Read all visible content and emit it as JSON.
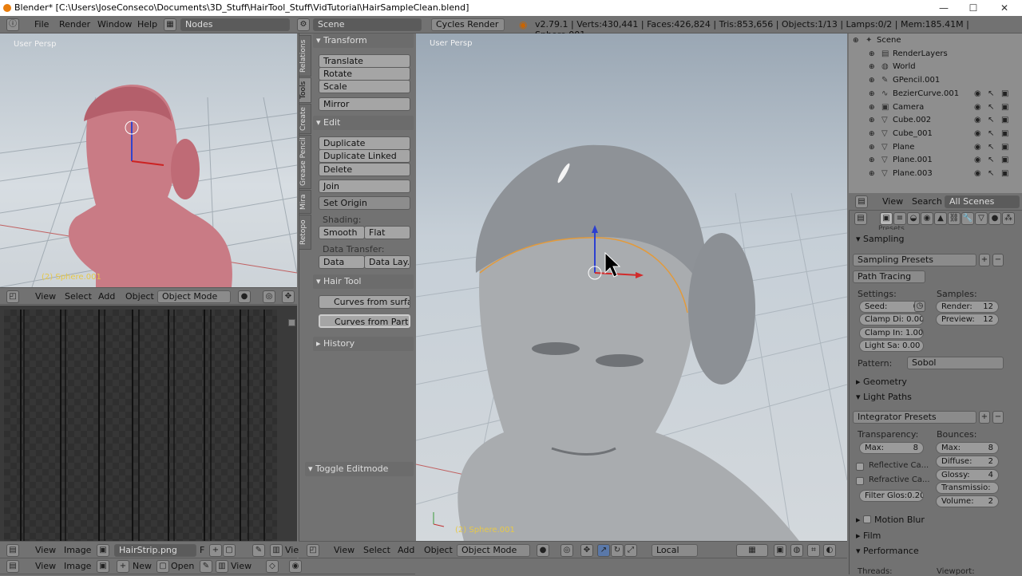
{
  "window": {
    "title": "Blender* [C:\\Users\\JoseConseco\\Documents\\3D_Stuff\\HairTool_Stuff\\VidTutorial\\HairSampleClean.blend]"
  },
  "info_header": {
    "menus": [
      "File",
      "Render",
      "Window",
      "Help"
    ],
    "screen_layout": "Nodes",
    "scene": "Scene",
    "render_engine": "Cycles Render",
    "stats": "v2.79.1 | Verts:430,441 | Faces:426,824 | Tris:853,656 | Objects:1/13 | Lamps:0/2 | Mem:185.41M | Sphere.001"
  },
  "left_viewport": {
    "label": "User Persp",
    "object_label": "(2) Sphere.001",
    "header": {
      "menus": [
        "View",
        "Select",
        "Add",
        "Object"
      ],
      "mode": "Object Mode"
    }
  },
  "tool_shelf": {
    "tabs": [
      "Relations",
      "Tools",
      "Create",
      "Grease Pencil",
      "Mira",
      "Retopo"
    ],
    "transform": {
      "title": "Transform",
      "buttons": [
        "Translate",
        "Rotate",
        "Scale",
        "Mirror"
      ]
    },
    "edit": {
      "title": "Edit",
      "buttons": [
        "Duplicate",
        "Duplicate Linked",
        "Delete",
        "Join",
        "Set Origin"
      ],
      "shading_label": "Shading:",
      "shading": [
        "Smooth",
        "Flat"
      ],
      "data_transfer_label": "Data Transfer:",
      "data_transfer": [
        "Data",
        "Data Lay..."
      ]
    },
    "hair_tool": {
      "title": "Hair Tool",
      "buttons": [
        "Curves from surface",
        "Curves from Particl..."
      ]
    },
    "history": {
      "title": "History"
    },
    "toggle": "Toggle Editmode"
  },
  "image_editor": {
    "header1": {
      "menus": [
        "View",
        "Image"
      ],
      "image_name": "HairStrip.png",
      "f_label": "F",
      "extra": "View"
    },
    "header2": {
      "menus": [
        "View",
        "Image"
      ],
      "new": "New",
      "open": "Open",
      "view": "View"
    }
  },
  "main_viewport": {
    "label": "User Persp",
    "object_label": "(2) Sphere.001",
    "header": {
      "menus": [
        "View",
        "Select",
        "Add",
        "Object"
      ],
      "mode": "Object Mode",
      "pivot": "Local"
    }
  },
  "outliner": {
    "items": [
      {
        "name": "Scene",
        "icon": "scene-icon"
      },
      {
        "name": "RenderLayers",
        "icon": "renderlayers-icon"
      },
      {
        "name": "World",
        "icon": "world-icon"
      },
      {
        "name": "GPencil.001",
        "icon": "gpencil-icon"
      },
      {
        "name": "BezierCurve.001",
        "icon": "curve-icon"
      },
      {
        "name": "Camera",
        "icon": "camera-icon"
      },
      {
        "name": "Cube.002",
        "icon": "mesh-icon"
      },
      {
        "name": "Cube_001",
        "icon": "mesh-icon"
      },
      {
        "name": "Plane",
        "icon": "mesh-icon"
      },
      {
        "name": "Plane.001",
        "icon": "mesh-icon"
      },
      {
        "name": "Plane.003",
        "icon": "mesh-icon"
      }
    ],
    "footer": {
      "view": "View",
      "search": "Search",
      "filter": "All Scenes"
    }
  },
  "properties": {
    "partial_header": "Presets",
    "sampling": {
      "title": "Sampling",
      "presets": "Sampling Presets",
      "method": "Path Tracing",
      "settings_label": "Settings:",
      "samples_label": "Samples:",
      "seed_label": "Seed:",
      "seed": "0",
      "clamp_direct": "Clamp Di: 0.00",
      "clamp_indirect": "Clamp In: 1.00",
      "light_sampling": "Light Sa:  0.00",
      "render_label": "Render:",
      "render": "12",
      "preview_label": "Preview:",
      "preview": "12",
      "pattern_label": "Pattern:",
      "pattern": "Sobol"
    },
    "geometry": {
      "title": "Geometry"
    },
    "light_paths": {
      "title": "Light Paths",
      "presets": "Integrator Presets",
      "transparency_label": "Transparency:",
      "bounces_label": "Bounces:",
      "trans_max_label": "Max:",
      "trans_max": "8",
      "reflective_caustics": "Reflective Ca...",
      "refractive_caustics": "Refractive Ca...",
      "filter_glossy": "Filter Glos:0.20",
      "max_label": "Max:",
      "max": "8",
      "diffuse_label": "Diffuse:",
      "diffuse": "2",
      "glossy_label": "Glossy:",
      "glossy": "4",
      "transmission_label": "Transmissio:",
      "transmission": "8",
      "volume_label": "Volume:",
      "volume": "2"
    },
    "motion_blur": {
      "title": "Motion Blur"
    },
    "film": {
      "title": "Film"
    },
    "performance": {
      "title": "Performance",
      "threads": "Threads:",
      "viewport": "Viewport:"
    }
  }
}
